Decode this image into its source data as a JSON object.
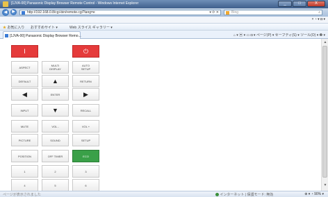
{
  "window": {
    "title": "[1JVA-00] Panasonic Display Browser Remote Control - Windows Internet Explorer",
    "min_label": "_",
    "max_label": "□",
    "close_label": "X"
  },
  "address": {
    "url": "http://192.168.0.8/cgi-bin/remote.cgi?lang=e",
    "back_label": "◀",
    "forward_label": "▶",
    "tools": "▾ ⟳ ✕",
    "search_placeholder": "Bing",
    "search_glyph": "⌕"
  },
  "menubar": {
    "right_links": "× ◔ ▾ ◘ ▾"
  },
  "favorites": {
    "item1": "お気に入り",
    "item2": "おすすめサイト ▾",
    "item3": "Web スライス ギャラリー ▾"
  },
  "tab": {
    "label": "[1JVA-00] Panasonic Display Browser Remo..."
  },
  "commandbar": {
    "text": "⌂ ▾  ▣ ▾  ▭ ◘ ▾  ページ(P) ▾  セーフティ(S) ▾  ツール(O) ▾  ❷ ▾"
  },
  "remote": {
    "standby": "I",
    "power": "⏻",
    "aspect": "ASPECT",
    "multi_display": "MULTI\nDISPLAY",
    "auto_setup": "AUTO\nSETUP",
    "default": "DEFAULT",
    "up": "▲",
    "return": "RETURN",
    "left": "◀",
    "enter": "ENTER",
    "right": "▶",
    "input": "INPUT",
    "down": "▼",
    "recall": "RECALL",
    "mute": "MUTE",
    "vol_minus": "VOL -",
    "vol_plus": "VOL +",
    "picture": "PICTURE",
    "sound": "SOUND",
    "setup": "SETUP",
    "position": "POSITION",
    "off_timer": "OFF TIMER",
    "eco": "ECO",
    "num1": "1",
    "num2": "2",
    "num3": "3",
    "num4": "4",
    "num5": "5",
    "num6": "6"
  },
  "statusbar": {
    "left": "ページが表示されました",
    "zone": "インターネット | 保護モード: 無効",
    "zoom": "⊕ ▾  ◔ 90% ▾"
  },
  "colors": {
    "standby_red": "#e53b3b",
    "power_red": "#e53b3b",
    "eco_green": "#3aa048"
  }
}
